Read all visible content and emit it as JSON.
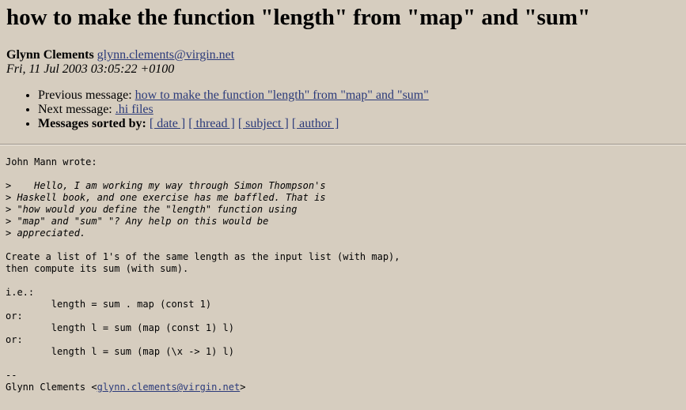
{
  "header": {
    "title": "how to make the function \"length\" from \"map\" and \"sum\""
  },
  "author": {
    "name": "Glynn Clements",
    "email_link": "glynn.clements@virgin.net ",
    "date": "Fri, 11 Jul 2003 03:05:22 +0100"
  },
  "nav": {
    "previous_label": "Previous message:",
    "previous_link": "how to make the function \"length\" from \"map\" and \"sum\"",
    "next_label": "Next message:",
    "next_link": ".hi files",
    "sorted_label": "Messages sorted by:",
    "sort_date": "[ date ]",
    "sort_thread": "[ thread ]",
    "sort_subject": "[ subject ]",
    "sort_author": "[ author ]"
  },
  "body": {
    "intro": "John Mann wrote:",
    "quote": [
      ">    Hello, I am working my way through Simon Thompson's",
      "> Haskell book, and one exercise has me baffled. That is",
      "> \"how would you define the \"length\" function using",
      "> \"map\" and \"sum\" \"? Any help on this would be",
      "> appreciated."
    ],
    "answer": [
      "Create a list of 1's of the same length as the input list (with map),",
      "then compute its sum (with sum)."
    ],
    "code": [
      "i.e.:",
      "        length = sum . map (const 1)",
      "or:",
      "        length l = sum (map (const 1) l)",
      "or:",
      "        length l = sum (map (\\x -> 1) l)"
    ],
    "sig_sep": "--",
    "sig_name": "Glynn Clements <",
    "sig_email": "glynn.clements@virgin.net",
    "sig_close": ">"
  }
}
